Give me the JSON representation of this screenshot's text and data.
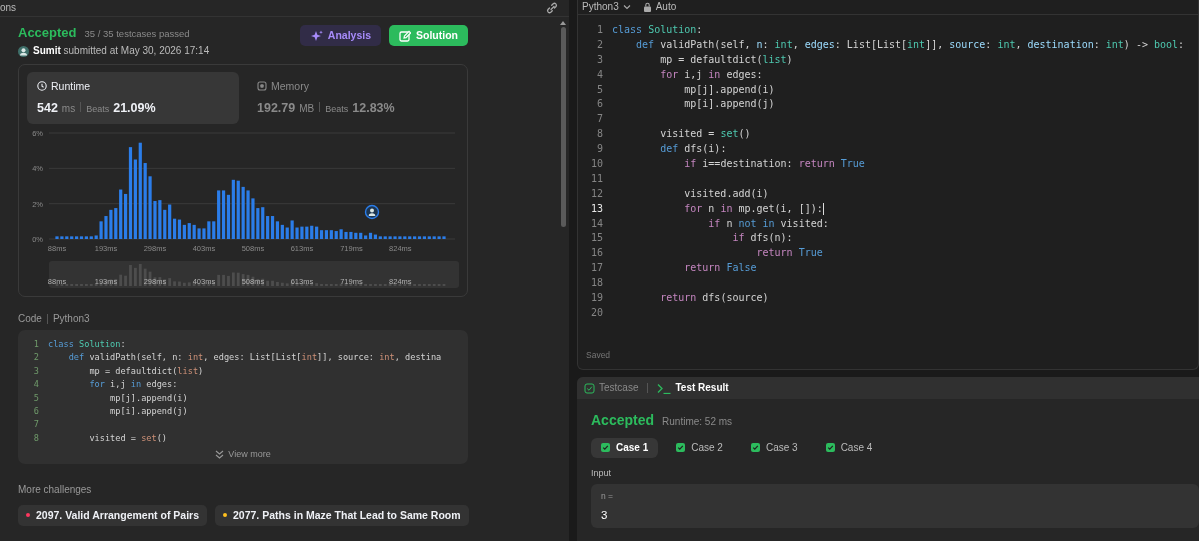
{
  "left_panel": {
    "tab_label": "ons",
    "result": {
      "status": "Accepted",
      "detail": "35 / 35 testcases passed",
      "submitted": "**Sumit** submitted at May 30, 2026 17:14"
    },
    "buttons": [
      {
        "label": "Analysis",
        "kind": "analysis"
      },
      {
        "label": "Solution",
        "kind": "solution"
      }
    ],
    "stats": [
      {
        "kind": "runtime",
        "label": "Runtime",
        "value": "542",
        "unit": "ms",
        "beats_label": "Beats",
        "beats": "21.09%",
        "selected": true
      },
      {
        "kind": "memory",
        "label": "Memory",
        "value": "192.79",
        "unit": "MB",
        "beats_label": "Beats",
        "beats": "12.83%",
        "selected": false
      }
    ],
    "chart_data": {
      "type": "bar",
      "xlim": [
        88,
        917.5
      ],
      "ylim": [
        0,
        6
      ],
      "x": [
        88,
        98.5,
        109,
        119.5,
        130,
        140.5,
        151,
        161.5,
        172,
        182.5,
        193,
        203.5,
        214,
        224.5,
        235,
        245.5,
        256,
        266.5,
        277,
        287.5,
        298,
        308.5,
        319,
        329.5,
        340,
        350.5,
        361,
        371.5,
        382,
        392.5,
        403,
        413.5,
        424,
        434.5,
        445,
        455.5,
        466,
        476.5,
        487,
        497.5,
        508,
        518.5,
        529,
        539.5,
        550,
        560.5,
        571,
        581.5,
        592,
        602.5,
        613,
        623.5,
        634,
        644.5,
        655,
        665.5,
        676,
        686.5,
        697,
        707.5,
        718,
        728.5,
        739,
        749.5,
        760,
        770.5,
        781,
        791.5,
        802,
        812.5,
        823,
        833.5,
        844,
        854.5,
        865,
        875.5,
        886,
        896.5,
        907,
        917.5
      ],
      "series": [
        {
          "color": "#2b7de9",
          "values": [
            0.15,
            0.15,
            0.15,
            0.15,
            0.15,
            0.15,
            0.15,
            0.15,
            0.2,
            1.0,
            1.3,
            1.65,
            1.75,
            2.8,
            2.55,
            5.2,
            4.5,
            5.45,
            4.3,
            3.55,
            2.15,
            2.2,
            1.65,
            1.95,
            1.15,
            1.1,
            0.8,
            0.9,
            0.8,
            0.6,
            0.6,
            1.0,
            1.0,
            2.75,
            2.75,
            2.5,
            3.35,
            3.3,
            2.95,
            2.75,
            2.3,
            1.75,
            1.8,
            1.3,
            1.3,
            1.0,
            0.8,
            0.65,
            1.05,
            0.65,
            0.7,
            0.7,
            0.75,
            0.7,
            0.5,
            0.5,
            0.5,
            0.45,
            0.55,
            0.4,
            0.4,
            0.35,
            0.35,
            0.2,
            0.35,
            0.25,
            0.15,
            0.15,
            0.15,
            0.15,
            0.15,
            0.15,
            0.15,
            0.15,
            0.15,
            0.15,
            0.15,
            0.15,
            0.15,
            0.15
          ]
        }
      ],
      "xticks": [
        {
          "value": 88,
          "label": "88ms"
        },
        {
          "value": 193,
          "label": "193ms"
        },
        {
          "value": 298,
          "label": "298ms"
        },
        {
          "value": 403,
          "label": "403ms"
        },
        {
          "value": 508,
          "label": "508ms"
        },
        {
          "value": 613,
          "label": "613ms"
        },
        {
          "value": 719,
          "label": "719ms"
        },
        {
          "value": 824,
          "label": "824ms"
        }
      ],
      "yticks": [
        {
          "value": 0,
          "label": "0%"
        },
        {
          "value": 2,
          "label": "2%"
        },
        {
          "value": 4,
          "label": "4%"
        },
        {
          "value": 6,
          "label": "6%"
        }
      ]
    },
    "overview": {
      "labels": [
        "88ms",
        "193ms",
        "298ms",
        "403ms",
        "508ms",
        "613ms",
        "719ms",
        "824ms"
      ]
    },
    "code_header": {
      "label": "Code",
      "language": "Python3"
    },
    "code_lines": [
      {
        "n": "1",
        "tokens": [
          {
            "t": "class ",
            "kind": "keyword"
          },
          {
            "t": "Solution",
            "kind": "classname"
          },
          {
            "t": ":",
            "kind": "plain"
          }
        ]
      },
      {
        "n": "2",
        "tokens": [
          {
            "t": "    def",
            "kind": "keyword"
          },
          {
            "t": " validPath(self, n: ",
            "kind": "plain"
          },
          {
            "t": "int",
            "kind": "literal"
          },
          {
            "t": ", edges: List[List[",
            "kind": "plain"
          },
          {
            "t": "int",
            "kind": "literal"
          },
          {
            "t": "]], source: ",
            "kind": "plain"
          },
          {
            "t": "int",
            "kind": "literal"
          },
          {
            "t": ", destina",
            "kind": "plain"
          }
        ]
      },
      {
        "n": "3",
        "tokens": [
          {
            "t": "        mp = defaultdict(",
            "kind": "plain"
          },
          {
            "t": "list",
            "kind": "literal"
          },
          {
            "t": ")",
            "kind": "plain"
          }
        ]
      },
      {
        "n": "4",
        "tokens": [
          {
            "t": "        for",
            "kind": "keyword"
          },
          {
            "t": " i,j ",
            "kind": "plain"
          },
          {
            "t": "in",
            "kind": "keyword"
          },
          {
            "t": " edges:",
            "kind": "plain"
          }
        ]
      },
      {
        "n": "5",
        "tokens": [
          {
            "t": "            mp[j].append(i)",
            "kind": "plain"
          }
        ]
      },
      {
        "n": "6",
        "tokens": [
          {
            "t": "            mp[i].append(j)",
            "kind": "plain"
          }
        ]
      },
      {
        "n": "7"
      },
      {
        "n": "8",
        "tokens": [
          {
            "t": "        visited = ",
            "kind": "plain"
          },
          {
            "t": "set",
            "kind": "literal"
          },
          {
            "t": "()",
            "kind": "plain"
          }
        ]
      }
    ],
    "view_more": "View more",
    "more_challenges": {
      "title": "More challenges",
      "items": [
        {
          "label": "2097. Valid Arrangement of Pairs",
          "color": "#ff375f"
        },
        {
          "label": "2077. Paths in Maze That Lead to Same Room",
          "color": "#ffc01e"
        }
      ]
    }
  },
  "editor": {
    "language": "Python3",
    "mode": "Auto",
    "status": "Saved",
    "lines": [
      {
        "n": "1",
        "current": false,
        "tokens": [
          {
            "t": "class ",
            "kind": "keyword"
          },
          {
            "t": "Solution",
            "kind": "classname"
          },
          {
            "t": ":",
            "kind": "plain"
          }
        ]
      },
      {
        "n": "2",
        "current": false,
        "tokens": [
          {
            "t": "    def",
            "kind": "keyword"
          },
          {
            "t": " validPath(self, ",
            "kind": "plain"
          },
          {
            "t": "n",
            "kind": "variable"
          },
          {
            "t": ": ",
            "kind": "plain"
          },
          {
            "t": "int",
            "kind": "type"
          },
          {
            "t": ", ",
            "kind": "plain"
          },
          {
            "t": "edges",
            "kind": "variable"
          },
          {
            "t": ": List[List[",
            "kind": "plain"
          },
          {
            "t": "int",
            "kind": "type"
          },
          {
            "t": "]], ",
            "kind": "plain"
          },
          {
            "t": "source",
            "kind": "variable"
          },
          {
            "t": ": ",
            "kind": "plain"
          },
          {
            "t": "int",
            "kind": "type"
          },
          {
            "t": ", ",
            "kind": "plain"
          },
          {
            "t": "destination",
            "kind": "variable"
          },
          {
            "t": ": ",
            "kind": "plain"
          },
          {
            "t": "int",
            "kind": "type"
          },
          {
            "t": ") -> ",
            "kind": "plain"
          },
          {
            "t": "bool",
            "kind": "type"
          },
          {
            "t": ":",
            "kind": "plain"
          }
        ]
      },
      {
        "n": "3",
        "current": false,
        "tokens": [
          {
            "t": "        mp = defaultdict(",
            "kind": "plain"
          },
          {
            "t": "list",
            "kind": "type"
          },
          {
            "t": ")",
            "kind": "plain"
          }
        ]
      },
      {
        "n": "4",
        "current": false,
        "tokens": [
          {
            "t": "        for",
            "kind": "control"
          },
          {
            "t": " i,j ",
            "kind": "plain"
          },
          {
            "t": "in",
            "kind": "control"
          },
          {
            "t": " edges:",
            "kind": "plain"
          }
        ]
      },
      {
        "n": "5",
        "current": false,
        "tokens": [
          {
            "t": "            mp[j].append(i)",
            "kind": "plain"
          }
        ]
      },
      {
        "n": "6",
        "current": false,
        "tokens": [
          {
            "t": "            mp[i].append(j)",
            "kind": "plain"
          }
        ]
      },
      {
        "n": "7",
        "current": false
      },
      {
        "n": "8",
        "current": false,
        "tokens": [
          {
            "t": "        visited = ",
            "kind": "plain"
          },
          {
            "t": "set",
            "kind": "type"
          },
          {
            "t": "()",
            "kind": "plain"
          }
        ]
      },
      {
        "n": "9",
        "current": false,
        "tokens": [
          {
            "t": "        def",
            "kind": "keyword"
          },
          {
            "t": " dfs(i):",
            "kind": "plain"
          }
        ]
      },
      {
        "n": "10",
        "current": false,
        "tokens": [
          {
            "t": "            if",
            "kind": "control"
          },
          {
            "t": " i==destination: ",
            "kind": "plain"
          },
          {
            "t": "return",
            "kind": "control"
          },
          {
            "t": " True",
            "kind": "keyword"
          }
        ]
      },
      {
        "n": "11",
        "current": false
      },
      {
        "n": "12",
        "current": false,
        "tokens": [
          {
            "t": "            visited.add(i)",
            "kind": "plain"
          }
        ]
      },
      {
        "n": "13",
        "current": true,
        "tokens": [
          {
            "t": "            for",
            "kind": "control"
          },
          {
            "t": " n ",
            "kind": "plain"
          },
          {
            "t": "in",
            "kind": "control"
          },
          {
            "t": " mp.get(i, []):",
            "kind": "plain"
          }
        ]
      },
      {
        "n": "14",
        "current": false,
        "tokens": [
          {
            "t": "                if",
            "kind": "control"
          },
          {
            "t": " n ",
            "kind": "plain"
          },
          {
            "t": "not in",
            "kind": "keyword"
          },
          {
            "t": " visited:",
            "kind": "plain"
          }
        ]
      },
      {
        "n": "15",
        "current": false,
        "tokens": [
          {
            "t": "                    if",
            "kind": "control"
          },
          {
            "t": " dfs(n):",
            "kind": "plain"
          }
        ]
      },
      {
        "n": "16",
        "current": false,
        "tokens": [
          {
            "t": "                        return",
            "kind": "control"
          },
          {
            "t": " True",
            "kind": "keyword"
          }
        ]
      },
      {
        "n": "17",
        "current": false,
        "tokens": [
          {
            "t": "            return",
            "kind": "control"
          },
          {
            "t": " False",
            "kind": "keyword"
          }
        ]
      },
      {
        "n": "18",
        "current": false
      },
      {
        "n": "19",
        "current": false,
        "tokens": [
          {
            "t": "        return",
            "kind": "control"
          },
          {
            "t": " dfs(source)",
            "kind": "plain"
          }
        ]
      },
      {
        "n": "20",
        "current": false
      }
    ]
  },
  "test_panel": {
    "tabs": [
      {
        "label": "Testcase",
        "kind": "testcase",
        "selected": false
      },
      {
        "label": "Test Result",
        "kind": "result",
        "selected": true
      }
    ],
    "status": "Accepted",
    "runtime": "Runtime: 52 ms",
    "cases": [
      {
        "label": "Case 1",
        "selected": true,
        "passed": true
      },
      {
        "label": "Case 2",
        "selected": false,
        "passed": true
      },
      {
        "label": "Case 3",
        "selected": false,
        "passed": true
      },
      {
        "label": "Case 4",
        "selected": false,
        "passed": true
      }
    ],
    "input_label": "Input",
    "inputs": [
      {
        "name": "n =",
        "value": "3"
      }
    ]
  }
}
